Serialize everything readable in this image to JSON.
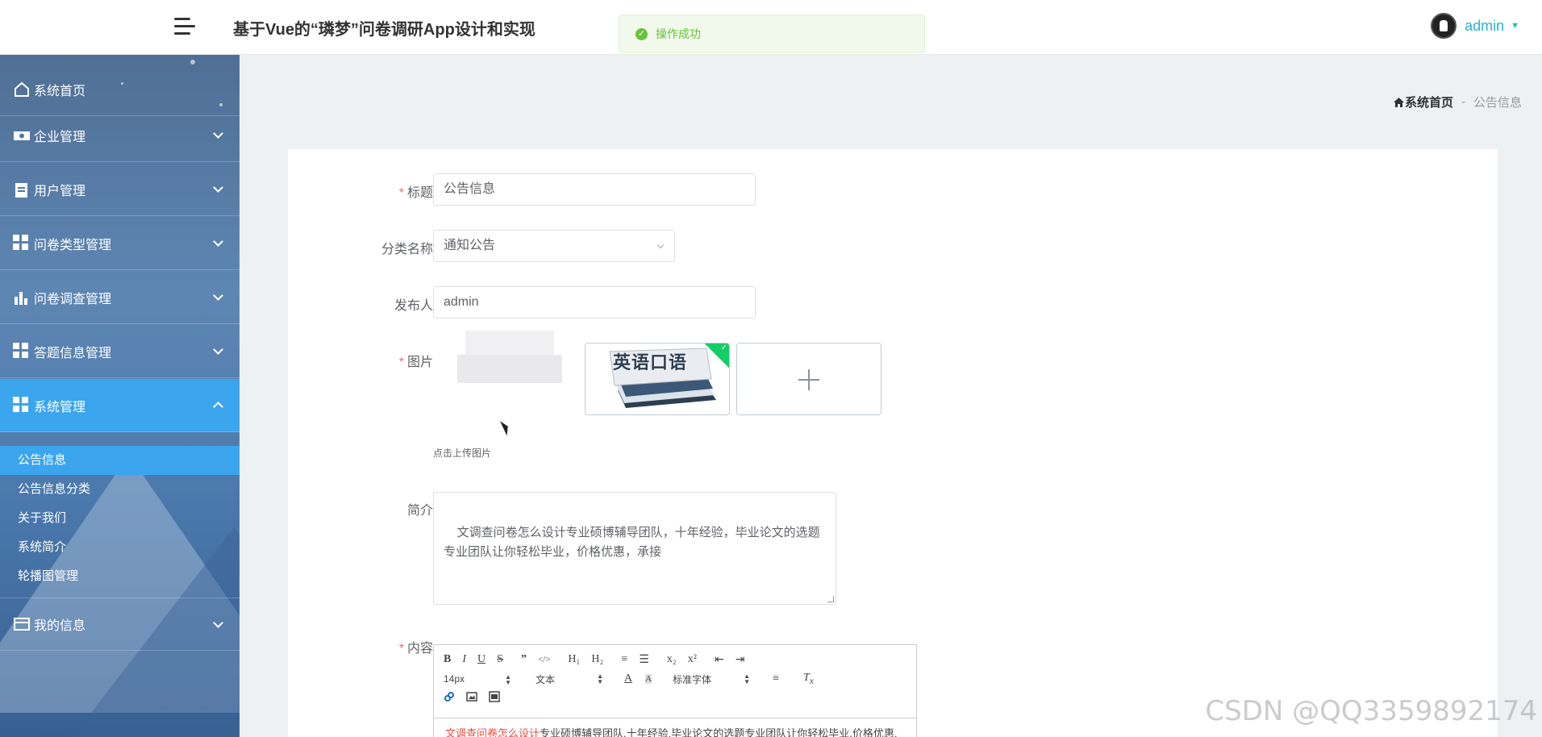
{
  "header": {
    "app_title": "基于Vue的“璘梦”问卷调研App设计和实现",
    "toast": "操作成功",
    "username": "admin",
    "accent_color": "#29b6c9"
  },
  "sidebar": {
    "items": [
      {
        "label": "系统首页",
        "icon": "home-icon"
      },
      {
        "label": "企业管理",
        "icon": "ticket-icon"
      },
      {
        "label": "用户管理",
        "icon": "clipboard-icon"
      },
      {
        "label": "问卷类型管理",
        "icon": "grid-icon"
      },
      {
        "label": "问卷调查管理",
        "icon": "bar-chart-icon"
      },
      {
        "label": "答题信息管理",
        "icon": "grid-icon"
      },
      {
        "label": "系统管理",
        "icon": "grid-icon",
        "expanded": true
      },
      {
        "label": "我的信息",
        "icon": "card-icon"
      }
    ],
    "sub_items": [
      "公告信息",
      "公告信息分类",
      "关于我们",
      "系统简介",
      "轮播图管理"
    ],
    "active_sub": "公告信息",
    "active_color": "#3ba5ee"
  },
  "breadcrumb": {
    "home": "系统首页",
    "separator": "-",
    "current": "公告信息"
  },
  "form": {
    "title_label": "标题",
    "title_value": "公告信息",
    "category_label": "分类名称",
    "category_value": "通知公告",
    "publisher_label": "发布人",
    "publisher_value": "admin",
    "image_label": "图片",
    "image_thumb_text": "英语口语",
    "upload_tip": "点击上传图片",
    "intro_label": "简介",
    "intro_value": "文调查问卷怎么设计专业硕博辅导团队，十年经验，毕业论文的选题专业团队让你轻松毕业，价格优惠，承接",
    "content_label": "内容",
    "required_mark": "*"
  },
  "editor": {
    "toolbar_row1": [
      "B",
      "I",
      "U",
      "S",
      "”",
      "</>",
      "H₁",
      "H₂",
      "≡",
      "☰",
      "x₂",
      "x²",
      "⇤",
      "⇥"
    ],
    "font_size": "14px",
    "paragraph": "文本",
    "font_family": "标准字体",
    "toolbar_row3": [
      "link-icon",
      "image-icon",
      "video-icon"
    ],
    "content_link": "文调查问卷怎么设计",
    "content_text": "专业硕博辅导团队,十年经验,毕业论文的选题专业团队让你轻松毕业,价格优惠,"
  },
  "watermark": "CSDN @QQ3359892174"
}
